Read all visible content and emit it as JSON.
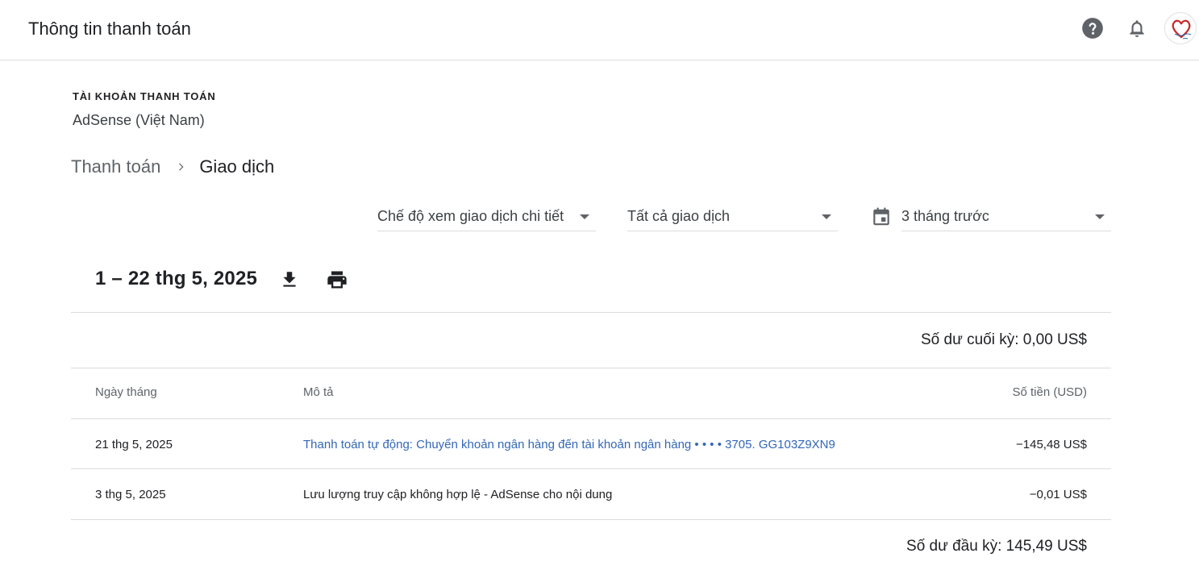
{
  "header": {
    "title": "Thông tin thanh toán",
    "icons": [
      "help-icon",
      "notifications-bell-icon",
      "account-avatar"
    ]
  },
  "account": {
    "label": "TÀI KHOẢN THANH TOÁN",
    "name": "AdSense (Việt Nam)"
  },
  "breadcrumb": {
    "parent": "Thanh toán",
    "current": "Giao dịch"
  },
  "filters": {
    "view_mode": "Chế độ xem giao dịch chi tiết",
    "transaction_type": "Tất cả giao dịch",
    "date_range": "3 tháng trước"
  },
  "period": {
    "label": "1 – 22 thg 5, 2025"
  },
  "balances": {
    "ending": "Số dư cuối kỳ: 0,00 US$",
    "starting": "Số dư đầu kỳ: 145,49 US$"
  },
  "table": {
    "headers": {
      "date": "Ngày tháng",
      "description": "Mô tả",
      "amount": "Số tiền (USD)"
    },
    "rows": [
      {
        "date": "21 thg 5, 2025",
        "description": "Thanh toán tự động: Chuyển khoản ngân hàng đến tài khoản ngân hàng  • • • • 3705. GG103Z9XN9",
        "amount": "−145,48 US$"
      },
      {
        "date": "3 thg 5, 2025",
        "description": "Lưu lượng truy cập không hợp lệ - AdSense cho nội dung",
        "amount": "−0,01 US$"
      }
    ]
  },
  "colors": {
    "link": "#3367b5",
    "divider": "#dadce0",
    "text_primary": "#202124",
    "text_secondary": "#5f6368"
  }
}
